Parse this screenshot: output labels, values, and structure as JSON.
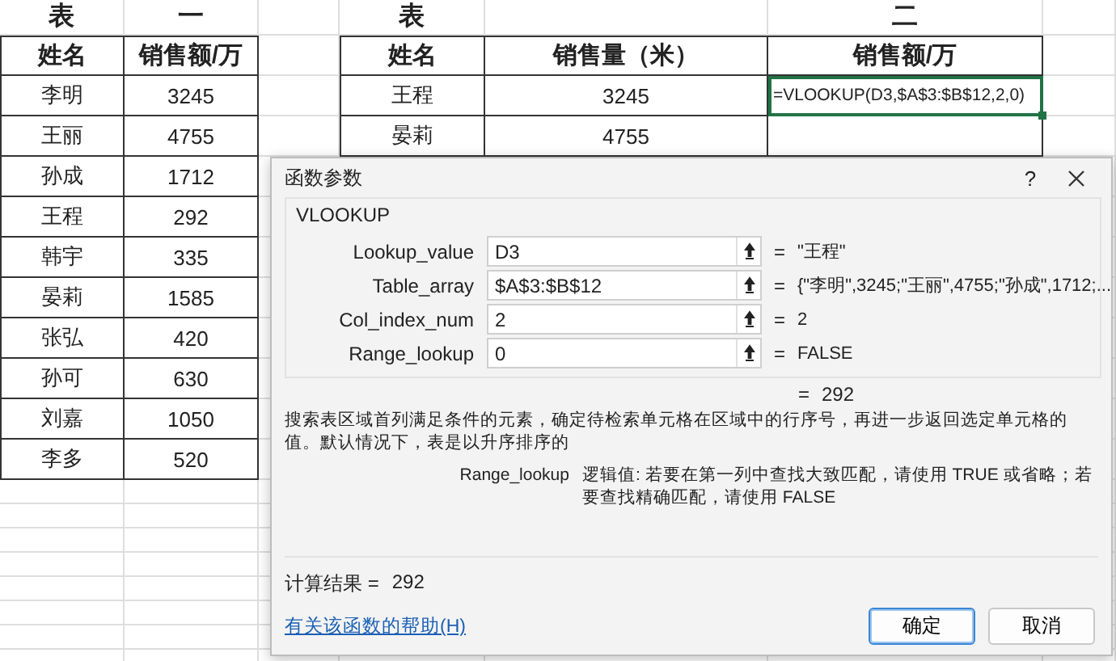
{
  "table_1": {
    "title": [
      "表",
      "一"
    ],
    "columns": [
      "姓名",
      "销售额/万"
    ],
    "rows": [
      [
        "李明",
        "3245"
      ],
      [
        "王丽",
        "4755"
      ],
      [
        "孙成",
        "1712"
      ],
      [
        "王程",
        "292"
      ],
      [
        "韩宇",
        "335"
      ],
      [
        "晏莉",
        "1585"
      ],
      [
        "张弘",
        "420"
      ],
      [
        "孙可",
        "630"
      ],
      [
        "刘嘉",
        "1050"
      ],
      [
        "李多",
        "520"
      ]
    ]
  },
  "table_2": {
    "title": [
      "表",
      "二"
    ],
    "columns": [
      "姓名",
      "销售量（米）",
      "销售额/万"
    ],
    "rows": [
      {
        "cells": [
          "王程",
          "3245",
          "=VLOOKUP(D3,$A$3:$B$12,2,0)"
        ],
        "selected": true
      },
      {
        "cells": [
          "晏莉",
          "4755"
        ],
        "selected": false
      }
    ]
  },
  "dialog": {
    "title": "函数参数",
    "help": "?",
    "function_name": "VLOOKUP",
    "arguments": [
      {
        "label": "Lookup_value",
        "value": "D3",
        "equals": "=",
        "result": "\"王程\""
      },
      {
        "label": "Table_array",
        "value": "$A$3:$B$12",
        "equals": "=",
        "result": "{\"李明\",3245;\"王丽\",4755;\"孙成\",1712;..."
      },
      {
        "label": "Col_index_num",
        "value": "2",
        "equals": "=",
        "result": "2"
      },
      {
        "label": "Range_lookup",
        "value": "0",
        "equals": "=",
        "result": "FALSE"
      }
    ],
    "formula_result": {
      "equals": "=",
      "value": "292"
    },
    "description": "搜索表区域首列满足条件的元素，确定待检索单元格在区域中的行序号，再进一步返回选定单元格的值。默认情况下，表是以升序排序的",
    "argument_help": {
      "name": "Range_lookup",
      "text": "逻辑值: 若要在第一列中查找大致匹配，请使用 TRUE 或省略；若要查找精确匹配，请使用 FALSE"
    },
    "calc_result": {
      "label": "计算结果 =",
      "value": "292"
    },
    "help_link": "有关该函数的帮助(H)",
    "buttons": [
      {
        "label": "确定",
        "default": true
      },
      {
        "label": "取消",
        "default": false
      }
    ]
  }
}
